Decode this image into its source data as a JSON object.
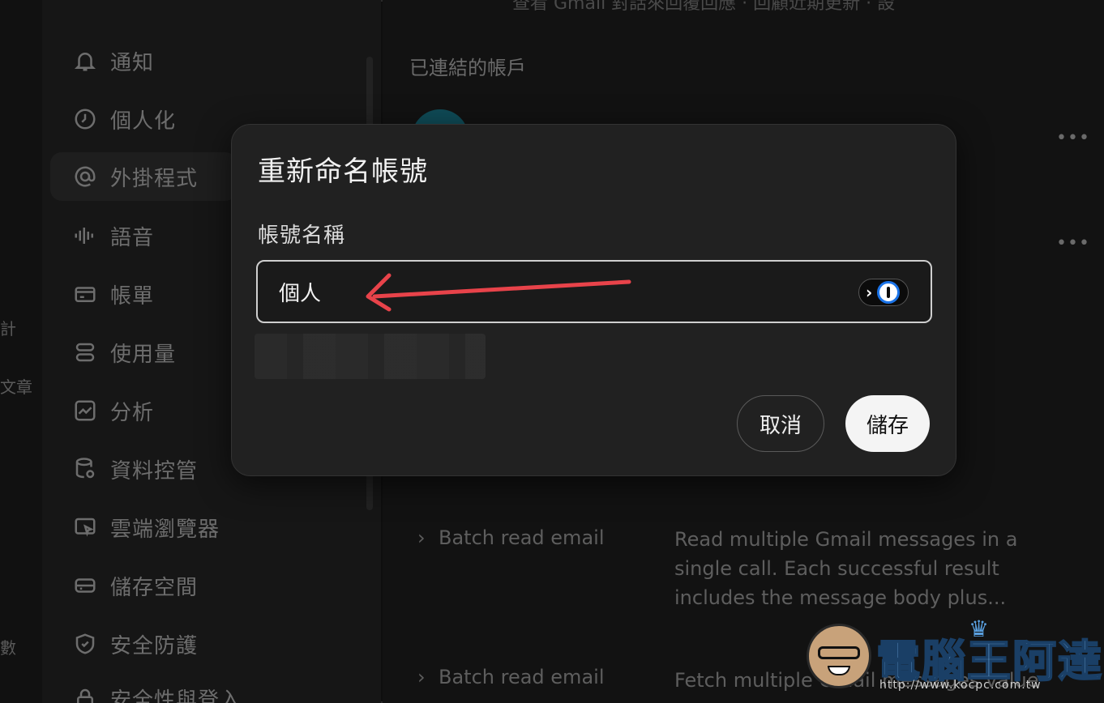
{
  "background": {
    "left_strip_fragments": [
      "計",
      "文章",
      "數"
    ],
    "top_cut_text": "查看 Gmail 對話來回覆回應 · 回顧近期更新 · 設",
    "section_title": "已連結的帳戶",
    "more_icon": "more-horizontal-icon",
    "tools": [
      {
        "name": "Batch read email",
        "description": "Read multiple Gmail messages in a single call. Each successful result includes the message body plus..."
      },
      {
        "name": "Batch read email",
        "description": "Fetch multiple Gmail messages value"
      }
    ]
  },
  "sidebar": {
    "items": [
      {
        "label": "通知",
        "icon": "bell-icon"
      },
      {
        "label": "個人化",
        "icon": "personalization-icon"
      },
      {
        "label": "外掛程式",
        "icon": "at-sign-icon",
        "active": true
      },
      {
        "label": "語音",
        "icon": "waveform-icon"
      },
      {
        "label": "帳單",
        "icon": "credit-card-icon"
      },
      {
        "label": "使用量",
        "icon": "usage-icon"
      },
      {
        "label": "分析",
        "icon": "analytics-icon"
      },
      {
        "label": "資料控管",
        "icon": "database-icon"
      },
      {
        "label": "雲端瀏覽器",
        "icon": "cloud-browser-icon"
      },
      {
        "label": "儲存空間",
        "icon": "storage-icon"
      },
      {
        "label": "安全防護",
        "icon": "shield-icon"
      },
      {
        "label": "安全性與登入",
        "icon": "lock-icon"
      }
    ]
  },
  "dialog": {
    "title": "重新命名帳號",
    "field_label": "帳號名稱",
    "field_value": "個人",
    "password_manager_icon": "1password-icon",
    "cancel_label": "取消",
    "save_label": "儲存"
  },
  "annotation": {
    "arrow_color": "#e8434a"
  },
  "watermark": {
    "title": "電腦王阿達",
    "url": "http://www.kocpc.com.tw"
  },
  "colors": {
    "dialog_bg": "#212121",
    "save_button_bg": "#f4f4f4"
  }
}
